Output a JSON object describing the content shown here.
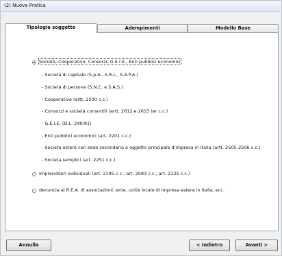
{
  "window": {
    "title": "(2) Nuova Pratica"
  },
  "tabs": [
    {
      "label": "Tipologia soggetto"
    },
    {
      "label": "Adempimenti"
    },
    {
      "label": "Modello Base"
    }
  ],
  "options": {
    "societa": {
      "label": "Società, Cooperative, Consorzi, G.E.I.E., Enti pubblici economici",
      "selected": true,
      "sub_items": [
        "- Società di capitale (S.p.A., S.R.L., S.A.P.A.)",
        "- Società di persone (S.N.C. e S.A.S.)",
        "- Cooperative (artt. 2200 c.c.)",
        "- Consorzi e società consortili (artt. 2612 e 2615 ter c.c.)",
        "- G.E.I.E. (D.L. 240/91)",
        "- Enti pubblici economici (art. 2201 c.c.)",
        "- Società estere con sede secondaria o oggetto principale d'impresa in Italia (artt. 2505-2506 c.c.)",
        "- Società semplici (art. 2251 c.c.)"
      ]
    },
    "imprenditori": {
      "label": "Imprenditori individuali (art. 2195 c.c., art. 2083 c.c., art. 2135 c.c.)",
      "selected": false
    },
    "rea": {
      "label": "denuncia al R.E.A. di associazioni, ente, unità locale di impresa estera in Italia, ecc.",
      "selected": false
    }
  },
  "buttons": {
    "annulla": "Annulla",
    "indietro": "< Indietro",
    "avanti": "Avanti >"
  }
}
